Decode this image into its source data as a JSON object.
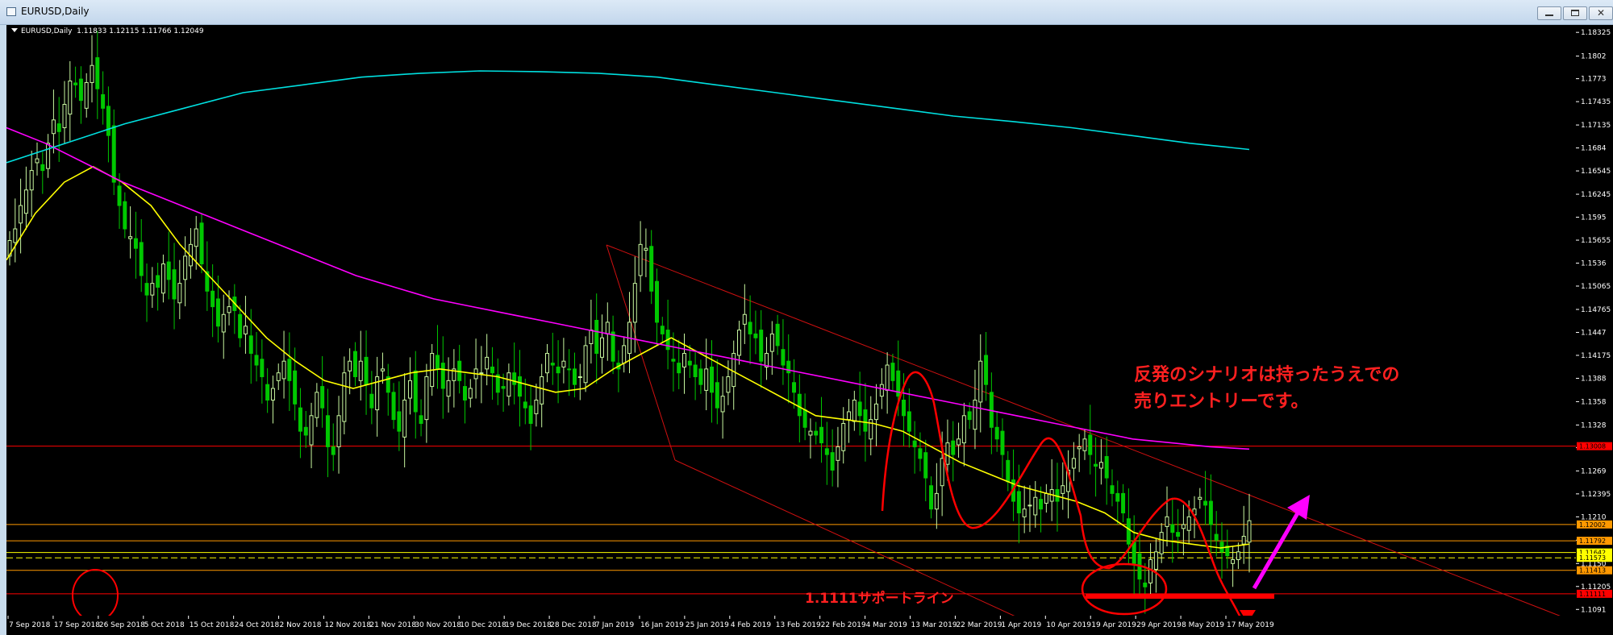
{
  "window": {
    "title": "EURUSD,Daily",
    "buttons": {
      "minimize": "minimize",
      "maximize": "maximize",
      "close": "close"
    }
  },
  "header": {
    "symbol_tf": "EURUSD,Daily",
    "ohlc": "1.11833 1.12115 1.11766 1.12049"
  },
  "annotations": {
    "note_line1": "反発のシナリオは持ったうえでの",
    "note_line2": "売りエントリーです。",
    "support_label": "1.1111サポートライン"
  },
  "colors": {
    "background": "#000000",
    "bull_candle": "#c8f7a0",
    "bear_candle": "#00c800",
    "ma_fast": "#ffff00",
    "ma_mid": "#ff00ff",
    "ma_slow": "#00e0e0",
    "annotation": "#ff0000",
    "arrow": "#ff00ff"
  },
  "chart_data": {
    "type": "candlestick",
    "symbol": "EURUSD",
    "timeframe": "Daily",
    "ohlc_last": {
      "open": 1.11833,
      "high": 1.12115,
      "low": 1.11766,
      "close": 1.12049
    },
    "x_tick_labels": [
      "7 Sep 2018",
      "17 Sep 2018",
      "26 Sep 2018",
      "5 Oct 2018",
      "15 Oct 2018",
      "24 Oct 2018",
      "2 Nov 2018",
      "12 Nov 2018",
      "21 Nov 2018",
      "30 Nov 2018",
      "10 Dec 2018",
      "19 Dec 2018",
      "28 Dec 2018",
      "7 Jan 2019",
      "16 Jan 2019",
      "25 Jan 2019",
      "4 Feb 2019",
      "13 Feb 2019",
      "22 Feb 2019",
      "4 Mar 2019",
      "13 Mar 2019",
      "22 Mar 2019",
      "1 Apr 2019",
      "10 Apr 2019",
      "19 Apr 2019",
      "29 Apr 2019",
      "8 May 2019",
      "17 May 2019"
    ],
    "y_tick_labels": [
      1.18325,
      1.1802,
      1.1773,
      1.17435,
      1.17135,
      1.1684,
      1.16545,
      1.16245,
      1.1595,
      1.15655,
      1.1536,
      1.15065,
      1.14765,
      1.1447,
      1.14175,
      1.1388,
      1.1358,
      1.1328,
      1.1299,
      1.1269,
      1.12395,
      1.121,
      1.118,
      1.115,
      1.11205,
      1.1091
    ],
    "ylim": [
      1.1083,
      1.1842
    ],
    "price_markers": [
      {
        "label": "1.13008",
        "value": 1.13008,
        "color": "#ff0000"
      },
      {
        "label": "1.12002",
        "value": 1.12002,
        "color": "#ff9900"
      },
      {
        "label": "1.11792",
        "value": 1.11792,
        "color": "#ff9900"
      },
      {
        "label": "1.11642",
        "value": 1.11642,
        "color": "#ffff00"
      },
      {
        "label": "1.11573",
        "value": 1.11573,
        "color": "#ffff00"
      },
      {
        "label": "1.11413",
        "value": 1.11413,
        "color": "#ff9900"
      },
      {
        "label": "1.11111",
        "value": 1.11111,
        "color": "#ff0000"
      }
    ],
    "horizontal_lines": [
      {
        "value": 1.13008,
        "color": "#ff0000"
      },
      {
        "value": 1.12002,
        "color": "#ff9900"
      },
      {
        "value": 1.11792,
        "color": "#ff9900"
      },
      {
        "value": 1.11642,
        "color": "#ffff00"
      },
      {
        "value": 1.11573,
        "color": "#ffff00",
        "dashed": true
      },
      {
        "value": 1.11413,
        "color": "#ff9900"
      },
      {
        "value": 1.11111,
        "color": "#ff0000"
      }
    ],
    "close_series": [
      1.1565,
      1.158,
      1.161,
      1.163,
      1.1655,
      1.167,
      1.1655,
      1.169,
      1.172,
      1.1705,
      1.174,
      1.177,
      1.1765,
      1.1745,
      1.1768,
      1.179,
      1.176,
      1.1735,
      1.17,
      1.164,
      1.161,
      1.158,
      1.157,
      1.1555,
      1.152,
      1.1495,
      1.151,
      1.1505,
      1.1535,
      1.1515,
      1.149,
      1.151,
      1.1545,
      1.156,
      1.158,
      1.1535,
      1.15,
      1.148,
      1.1455,
      1.147,
      1.148,
      1.1475,
      1.144,
      1.1455,
      1.142,
      1.1405,
      1.139,
      1.136,
      1.1375,
      1.1395,
      1.141,
      1.1385,
      1.1355,
      1.132,
      1.1315,
      1.134,
      1.137,
      1.135,
      1.13,
      1.129,
      1.134,
      1.1395,
      1.141,
      1.139,
      1.141,
      1.138,
      1.135,
      1.139,
      1.14,
      1.137,
      1.1335,
      1.132,
      1.136,
      1.1385,
      1.1345,
      1.133,
      1.139,
      1.142,
      1.14,
      1.1375,
      1.1385,
      1.14,
      1.1385,
      1.136,
      1.1375,
      1.14,
      1.1395,
      1.1415,
      1.1395,
      1.137,
      1.1375,
      1.1395,
      1.138,
      1.1365,
      1.135,
      1.133,
      1.136,
      1.139,
      1.142,
      1.1405,
      1.1395,
      1.141,
      1.14,
      1.138,
      1.139,
      1.143,
      1.145,
      1.142,
      1.144,
      1.146,
      1.141,
      1.14,
      1.143,
      1.146,
      1.151,
      1.156,
      1.1555,
      1.15,
      1.146,
      1.1445,
      1.1425,
      1.141,
      1.1395,
      1.142,
      1.1405,
      1.139,
      1.138,
      1.14,
      1.137,
      1.135,
      1.1365,
      1.139,
      1.142,
      1.145,
      1.147,
      1.1445,
      1.144,
      1.141,
      1.142,
      1.1445,
      1.143,
      1.1405,
      1.1395,
      1.137,
      1.134,
      1.1325,
      1.132,
      1.1315,
      1.1305,
      1.129,
      1.127,
      1.13,
      1.133,
      1.1345,
      1.136,
      1.134,
      1.132,
      1.1335,
      1.1355,
      1.138,
      1.1405,
      1.1385,
      1.1365,
      1.134,
      1.132,
      1.13,
      1.1285,
      1.126,
      1.122,
      1.124,
      1.1285,
      1.1305,
      1.129,
      1.131,
      1.134,
      1.1335,
      1.136,
      1.141,
      1.138,
      1.1325,
      1.131,
      1.129,
      1.1255,
      1.123,
      1.1215,
      1.122,
      1.1225,
      1.1235,
      1.122,
      1.124,
      1.1245,
      1.123,
      1.125,
      1.127,
      1.1285,
      1.13,
      1.131,
      1.129,
      1.1275,
      1.128,
      1.126,
      1.124,
      1.123,
      1.1215,
      1.1175,
      1.115,
      1.113,
      1.112,
      1.1155,
      1.1165,
      1.119,
      1.121,
      1.119,
      1.1185,
      1.12,
      1.121,
      1.122,
      1.1235,
      1.1225,
      1.12,
      1.118,
      1.1165,
      1.116,
      1.1155,
      1.1165,
      1.1185,
      1.1205
    ],
    "moving_averages": [
      {
        "color": "#ffff00",
        "start": 1.154,
        "values": [
          1.154,
          1.16,
          1.164,
          1.166,
          1.164,
          1.161,
          1.156,
          1.152,
          1.148,
          1.144,
          1.141,
          1.1385,
          1.1375,
          1.1385,
          1.1395,
          1.14,
          1.1395,
          1.139,
          1.138,
          1.137,
          1.1375,
          1.14,
          1.142,
          1.144,
          1.142,
          1.14,
          1.138,
          1.136,
          1.134,
          1.1335,
          1.133,
          1.132,
          1.13,
          1.128,
          1.1265,
          1.125,
          1.124,
          1.123,
          1.1215,
          1.119,
          1.118,
          1.1175,
          1.117,
          1.1175
        ]
      },
      {
        "color": "#ff00ff",
        "values": [
          1.171,
          1.169,
          1.1665,
          1.164,
          1.162,
          1.16,
          1.158,
          1.156,
          1.154,
          1.152,
          1.1505,
          1.149,
          1.148,
          1.147,
          1.146,
          1.145,
          1.144,
          1.143,
          1.142,
          1.141,
          1.14,
          1.139,
          1.138,
          1.137,
          1.136,
          1.135,
          1.134,
          1.133,
          1.132,
          1.131,
          1.1305,
          1.13,
          1.1297
        ]
      },
      {
        "color": "#00e0e0",
        "values": [
          1.1665,
          1.169,
          1.1715,
          1.1735,
          1.1755,
          1.1765,
          1.1775,
          1.178,
          1.1783,
          1.1782,
          1.178,
          1.1775,
          1.1765,
          1.1755,
          1.1745,
          1.1735,
          1.1725,
          1.1718,
          1.171,
          1.17,
          1.169,
          1.1682
        ]
      }
    ]
  }
}
